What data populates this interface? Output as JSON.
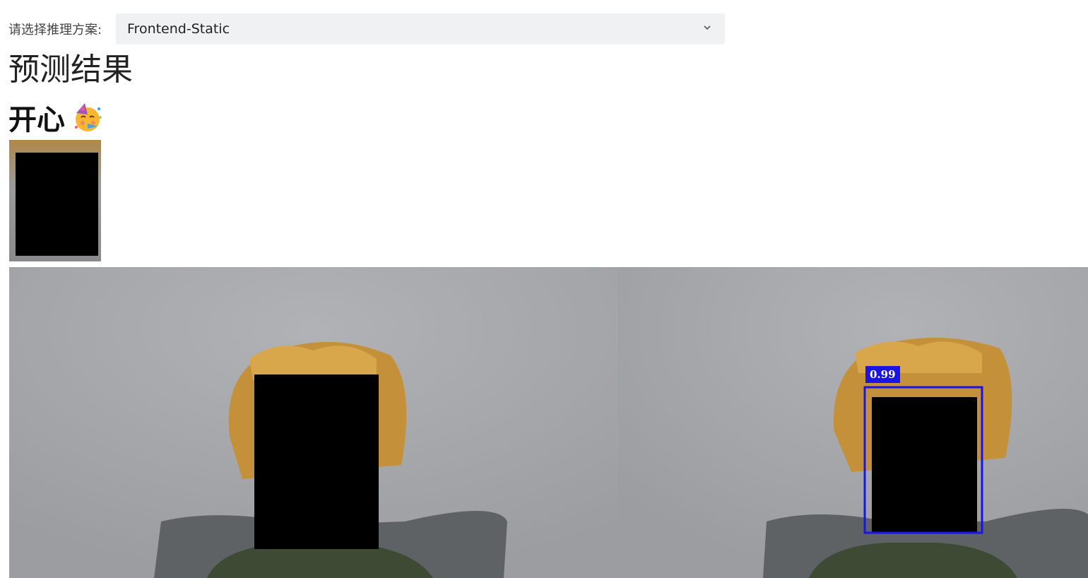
{
  "scheme_selector": {
    "label": "请选择推理方案:",
    "selected": "Frontend-Static"
  },
  "result": {
    "heading": "预测结果",
    "emotion": "开心",
    "emotion_icon": "party-face-icon"
  },
  "detection": {
    "score": "0.99",
    "box_color": "#1a14e6"
  },
  "colors": {
    "select_bg": "#f0f1f3",
    "backdrop": "#a7a8ab"
  }
}
